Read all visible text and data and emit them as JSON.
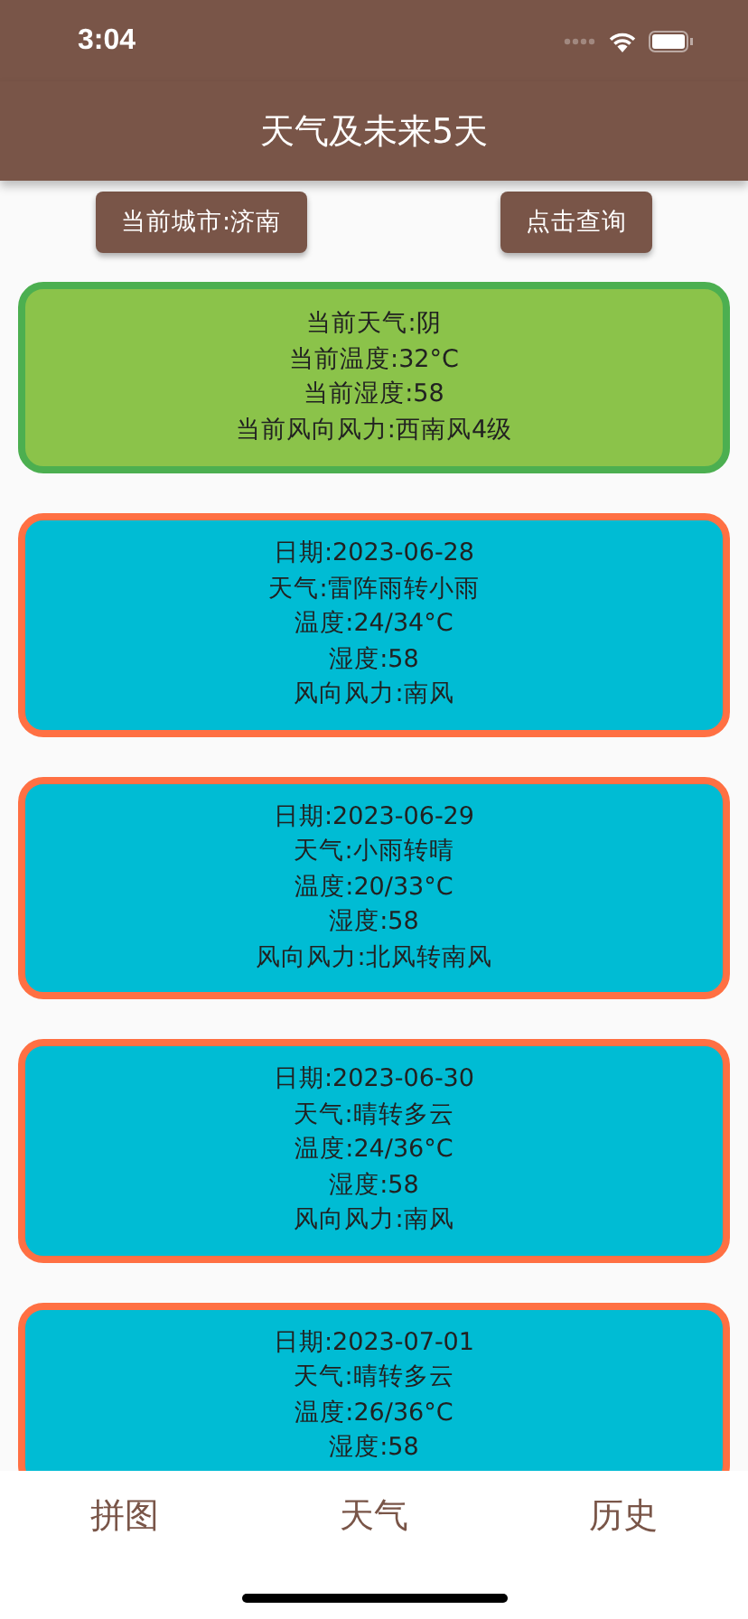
{
  "status_bar": {
    "time": "3:04"
  },
  "app_bar": {
    "title": "天气及未来5天"
  },
  "buttons": [
    {
      "label": "当前城市:济南"
    },
    {
      "label": "点击查询"
    }
  ],
  "current": {
    "lines": [
      "当前天气:阴",
      "当前温度:32°C",
      "当前湿度:58",
      "当前风向风力:西南风4级"
    ]
  },
  "forecast": [
    {
      "lines": [
        "日期:2023-06-28",
        "天气:雷阵雨转小雨",
        "温度:24/34°C",
        "湿度:58",
        "风向风力:南风"
      ]
    },
    {
      "lines": [
        "日期:2023-06-29",
        "天气:小雨转晴",
        "温度:20/33°C",
        "湿度:58",
        "风向风力:北风转南风"
      ]
    },
    {
      "lines": [
        "日期:2023-06-30",
        "天气:晴转多云",
        "温度:24/36°C",
        "湿度:58",
        "风向风力:南风"
      ]
    },
    {
      "lines": [
        "日期:2023-07-01",
        "天气:晴转多云",
        "温度:26/36°C",
        "湿度:58"
      ]
    }
  ],
  "tabs": [
    {
      "label": "拼图"
    },
    {
      "label": "天气"
    },
    {
      "label": "历史"
    }
  ]
}
